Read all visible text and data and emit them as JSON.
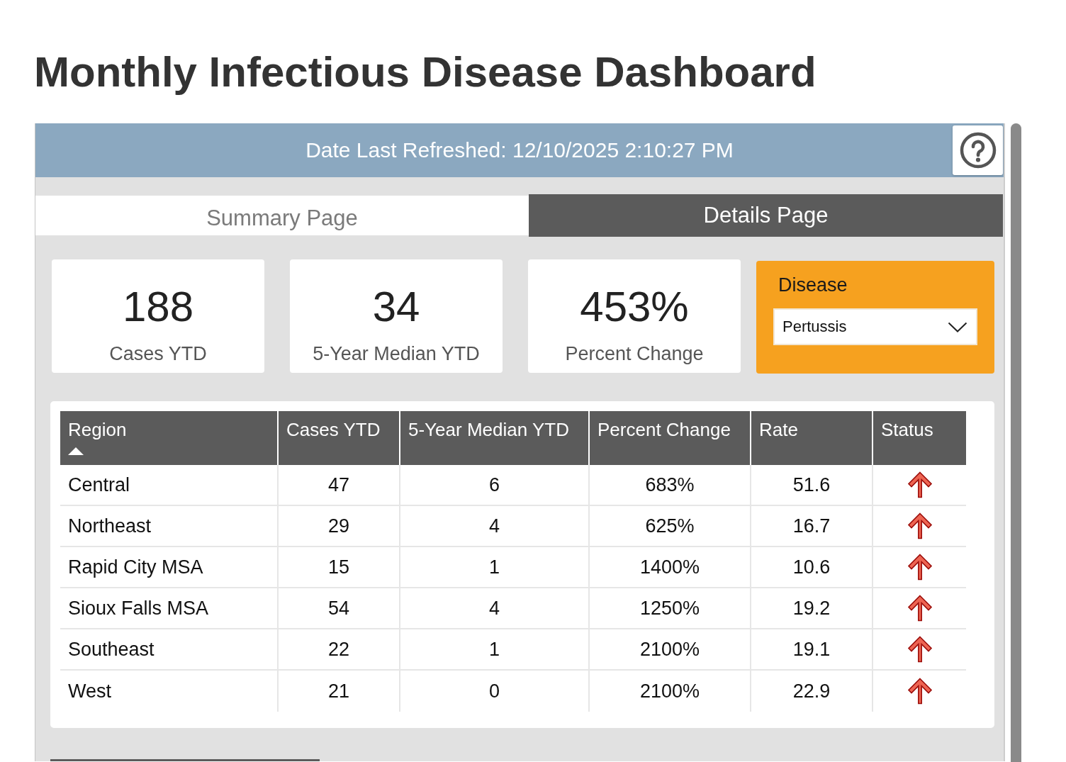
{
  "title": "Monthly Infectious Disease Dashboard",
  "refresh_bar": {
    "text": "Date Last Refreshed: 12/10/2025 2:10:27 PM"
  },
  "tabs": [
    {
      "label": "Summary Page",
      "selected": false
    },
    {
      "label": "Details Page",
      "selected": true
    }
  ],
  "kpis": [
    {
      "value": "188",
      "label": "Cases YTD"
    },
    {
      "value": "34",
      "label": "5-Year Median YTD"
    },
    {
      "value": "453%",
      "label": "Percent Change"
    }
  ],
  "filter": {
    "label": "Disease",
    "value": "Pertussis"
  },
  "table": {
    "columns": [
      {
        "label": "Region",
        "sorted": true
      },
      {
        "label": "Cases YTD",
        "sorted": false
      },
      {
        "label": "5-Year Median YTD",
        "sorted": false
      },
      {
        "label": "Percent Change",
        "sorted": false
      },
      {
        "label": "Rate",
        "sorted": false
      },
      {
        "label": "Status",
        "sorted": false
      }
    ],
    "rows": [
      {
        "cells": [
          "Central",
          "47",
          "6",
          "683%",
          "51.6"
        ],
        "rising": true
      },
      {
        "cells": [
          "Northeast",
          "29",
          "4",
          "625%",
          "16.7"
        ],
        "rising": true
      },
      {
        "cells": [
          "Rapid City MSA",
          "15",
          "1",
          "1400%",
          "10.6"
        ],
        "rising": true
      },
      {
        "cells": [
          "Sioux Falls MSA",
          "54",
          "4",
          "1250%",
          "19.2"
        ],
        "rising": true
      },
      {
        "cells": [
          "Southeast",
          "22",
          "1",
          "2100%",
          "19.1"
        ],
        "rising": true
      },
      {
        "cells": [
          "West",
          "21",
          "0",
          "2100%",
          "22.9"
        ],
        "rising": true
      }
    ]
  }
}
